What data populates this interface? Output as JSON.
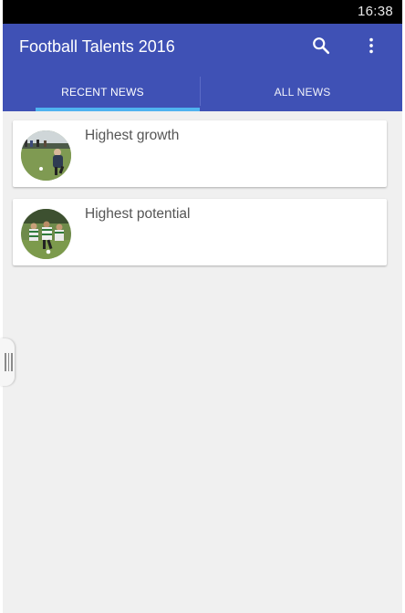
{
  "status_bar": {
    "time": "16:38"
  },
  "app_bar": {
    "title": "Football Talents 2016",
    "actions": [
      {
        "icon": "search-icon"
      },
      {
        "icon": "more-vert-icon"
      }
    ]
  },
  "tabs": [
    {
      "label": "RECENT NEWS",
      "selected": true
    },
    {
      "label": "ALL NEWS",
      "selected": false
    }
  ],
  "colors": {
    "app_bar": "#3f51b5",
    "tab_indicator": "#4fb3f0",
    "background": "#f0f0f0"
  },
  "news": [
    {
      "title": "Highest growth",
      "thumbnail": "football-player-photo"
    },
    {
      "title": "Highest potential",
      "thumbnail": "football-match-photo"
    }
  ]
}
